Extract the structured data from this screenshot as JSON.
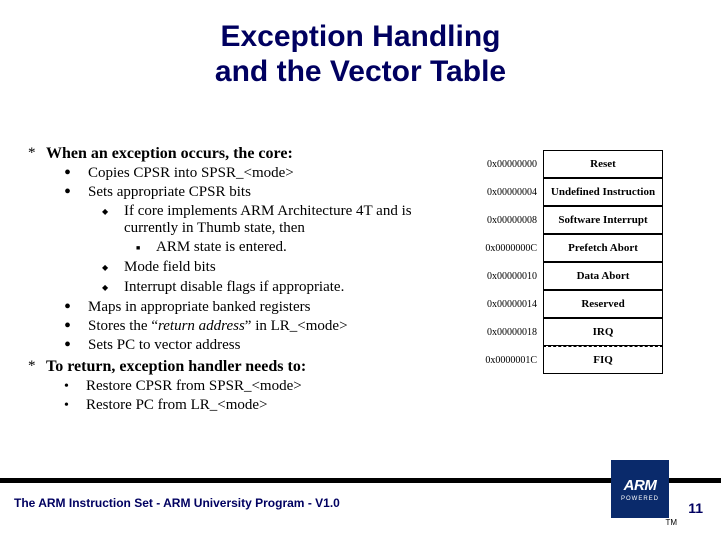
{
  "title_line1": "Exception Handling",
  "title_line2": "and the Vector Table",
  "s1": {
    "head": "When an exception occurs, the core:",
    "b1": "Copies CPSR into SPSR_<mode>",
    "b2": "Sets appropriate CPSR bits",
    "b2a": "If core implements ARM Architecture 4T and is currently in Thumb state, then",
    "b2a1": "ARM state is entered.",
    "b2b": "Mode field bits",
    "b2c": "Interrupt disable flags if appropriate.",
    "b3": "Maps in appropriate banked registers",
    "b4_pre": "Stores the “",
    "b4_em": "return address",
    "b4_post": "” in LR_<mode>",
    "b5": "Sets PC to vector address"
  },
  "s2": {
    "head": "To return, exception handler needs to:",
    "b1": "Restore CPSR from SPSR_<mode>",
    "b2": "Restore PC from LR_<mode>"
  },
  "vtable": [
    {
      "addr": "0x00000000",
      "label": "Reset"
    },
    {
      "addr": "0x00000004",
      "label": "Undefined Instruction"
    },
    {
      "addr": "0x00000008",
      "label": "Software Interrupt"
    },
    {
      "addr": "0x0000000C",
      "label": "Prefetch Abort"
    },
    {
      "addr": "0x00000010",
      "label": "Data Abort"
    },
    {
      "addr": "0x00000014",
      "label": "Reserved"
    },
    {
      "addr": "0x00000018",
      "label": "IRQ"
    },
    {
      "addr": "0x0000001C",
      "label": "FIQ"
    }
  ],
  "footer": "The ARM Instruction Set - ARM University Program - V1.0",
  "page": "11",
  "logo": {
    "brand": "ARM",
    "tag": "POWERED",
    "tm": "TM"
  }
}
